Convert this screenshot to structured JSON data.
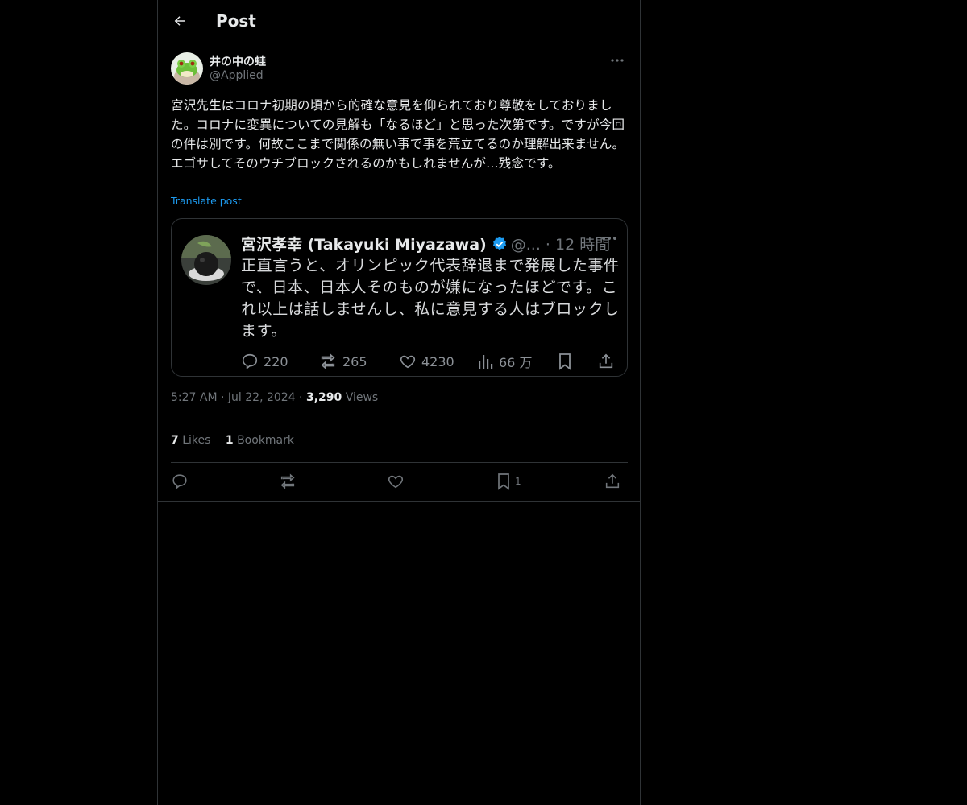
{
  "header": {
    "title": "Post",
    "back_icon": "arrow-left-icon"
  },
  "author": {
    "name": "井の中の蛙",
    "handle": "@Applied",
    "avatar": "frog-avatar"
  },
  "tweet": {
    "text": "宮沢先生はコロナ初期の頃から的確な意見を仰られており尊敬をしておりました。コロナに変異についての見解も「なるほど」と思った次第です。ですが今回の件は別です。何故ここまで関係の無い事で事を荒立てるのか理解出来ません。エゴサしてそのウチブロックされるのかもしれませんが…残念です。",
    "translate_label": "Translate post"
  },
  "embedded": {
    "name": "宮沢孝幸 (Takayuki Miyazawa)",
    "meta": "@... · 12 時間",
    "text": "正直言うと、オリンピック代表辞退まで発展した事件で、日本、日本人そのものが嫌になったほどです。これ以上は話しませんし、私に意見する人はブロックします。",
    "replies": "220",
    "reposts": "265",
    "likes": "4230",
    "views": "66 万"
  },
  "meta": {
    "time": "5:27 AM",
    "date": "Jul 22, 2024",
    "views_count": "3,290",
    "views_label": "Views"
  },
  "stats": {
    "likes_count": "7",
    "likes_label": "Likes",
    "bookmarks_count": "1",
    "bookmarks_label": "Bookmark"
  },
  "actions": {
    "bookmark_count": "1"
  },
  "colors": {
    "background": "#000000",
    "text": "#e7e9ea",
    "muted": "#71767b",
    "link": "#1d9bf0",
    "border": "#2f3336"
  }
}
